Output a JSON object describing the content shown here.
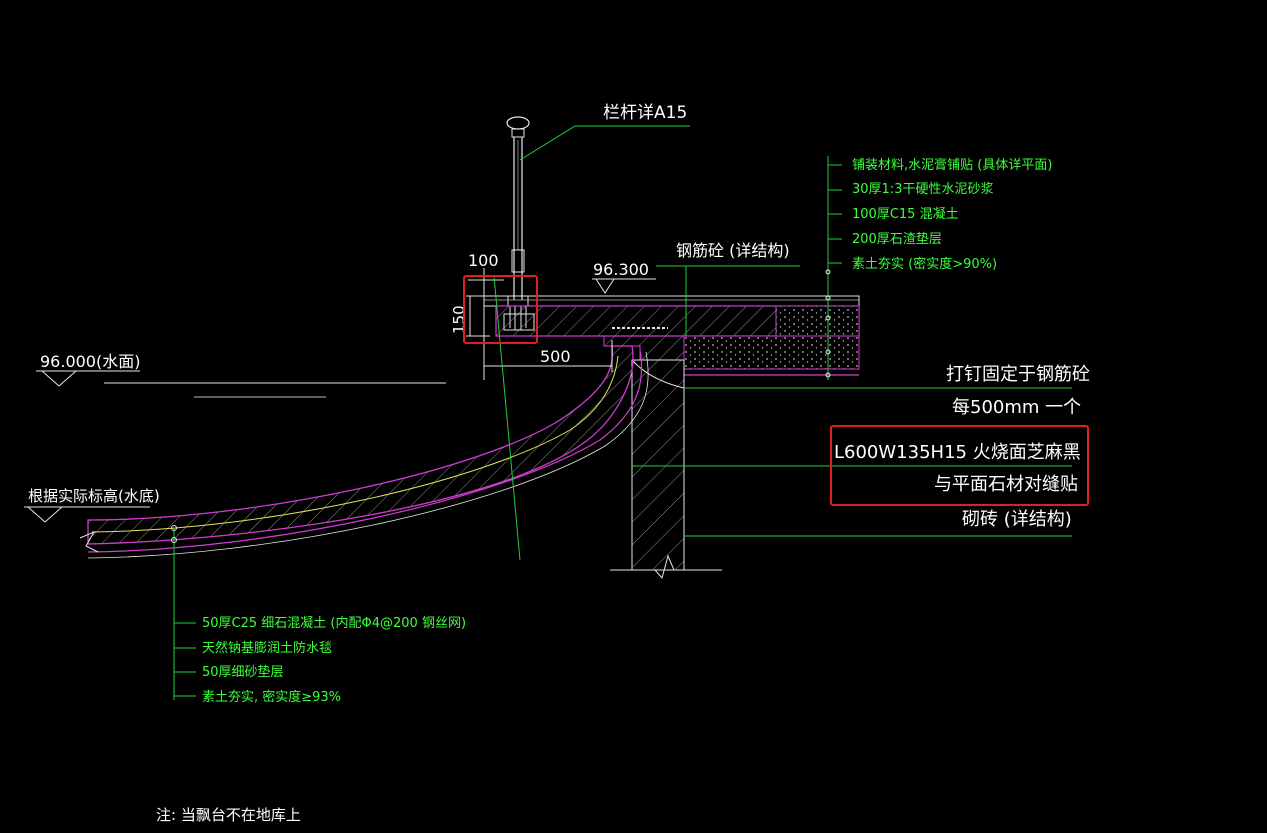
{
  "labels": {
    "railing": "栏杆详A15",
    "rc_concrete": "钢筋砼 (详结构)",
    "dim_100": "100",
    "dim_150": "150",
    "dim_500": "500",
    "elev_deck": "96.300",
    "elev_water": "96.000(水面)",
    "elev_bottom": "根据实际标高(水底)",
    "nail_1": "打钉固定于钢筋砼",
    "nail_2": "每500mm 一个",
    "stone_1": "L600W135H15 火烧面芝麻黑",
    "stone_2": "与平面石材对缝贴",
    "brick": "砌砖 (详结构)",
    "note": "注: 当飘台不在地库上"
  },
  "deck_layers": [
    "铺装材料,水泥膏铺贴 (具体详平面)",
    "30厚1:3干硬性水泥砂浆",
    "100厚C15 混凝土",
    "200厚石渣垫层",
    "素土夯实 (密实度>90%)"
  ],
  "slope_layers": [
    "50厚C25 细石混凝土 (内配Φ4@200 钢丝网)",
    "天然钠基膨润土防水毯",
    "50厚细砂垫层",
    "素土夯实, 密实度≥93%"
  ],
  "colors": {
    "background": "#000000",
    "text_white": "#ffffff",
    "text_green": "#3cff3c",
    "leader_green": "#1fcf3a",
    "layer_magenta": "#d23cd2",
    "hatch_gray": "#8c8c8c",
    "highlight_red": "#e02020",
    "curve_yellow": "#e8e060"
  }
}
